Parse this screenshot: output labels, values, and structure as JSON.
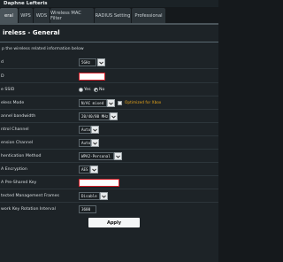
{
  "header": {
    "brand": "Daphne Lefteris",
    "sub": ""
  },
  "tabs": [
    {
      "label": "eral",
      "active": true
    },
    {
      "label": "WPS"
    },
    {
      "label": "WDS"
    },
    {
      "label": "Wireless MAC Filter"
    },
    {
      "label": "RADIUS Setting"
    },
    {
      "label": "Professional"
    }
  ],
  "page": {
    "title": "ireless - General",
    "description": "p the wireless related information below"
  },
  "form": {
    "band": {
      "label": "d",
      "value": "5GHz"
    },
    "ssid": {
      "label": "D"
    },
    "hide_ssid": {
      "label": "e SSID",
      "yes": "Yes",
      "no": "No",
      "selected": "no"
    },
    "mode": {
      "label": "eless Mode",
      "value": "N/AC mixed",
      "hint": "Optimized for Xbox"
    },
    "bandwidth": {
      "label": "annel bandwidth",
      "value": "20/40/80 MHz"
    },
    "control_channel": {
      "label": "ntrol Channel",
      "value": "Auto"
    },
    "extension_channel": {
      "label": "ension Channel",
      "value": "Auto"
    },
    "auth_method": {
      "label": "hentication Method",
      "value": "WPA2-Personal"
    },
    "encryption": {
      "label": "A Encryption",
      "value": "AES"
    },
    "psk": {
      "label": "A Pre-Shared Key"
    },
    "pmf": {
      "label": "tected Management Frames",
      "value": "Disable"
    },
    "rekey": {
      "label": "work Key Rotation Interval",
      "value": "3600"
    }
  },
  "actions": {
    "apply_label": "Apply"
  },
  "colors": {
    "accent_orange": "#e3a21a",
    "error_red": "#d4202a",
    "panel": "#1d2327"
  }
}
